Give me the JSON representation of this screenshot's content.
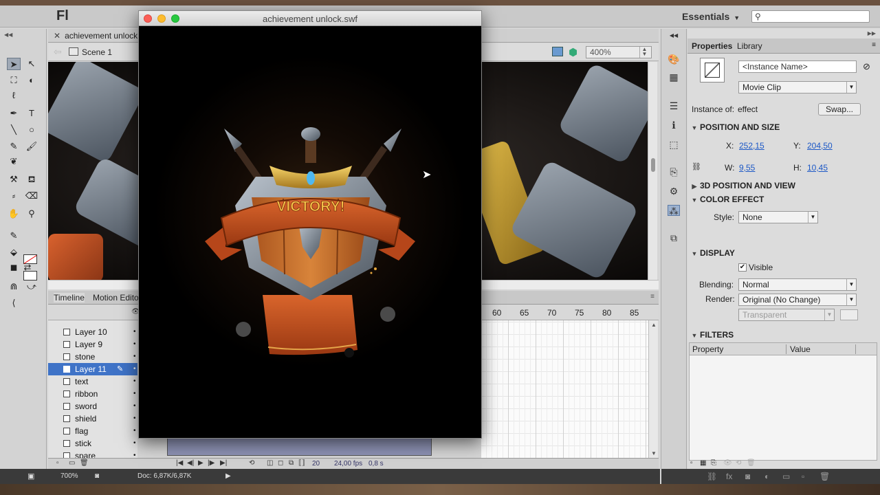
{
  "app": {
    "logo": "Fl",
    "workspace": "Essentials",
    "search_placeholder": ""
  },
  "document": {
    "tab_label": "achievement unlock.f",
    "scene_label": "Scene 1",
    "zoom": "400%"
  },
  "timeline": {
    "tabs": [
      "Timeline",
      "Motion Edito"
    ],
    "frame_numbers": [
      "60",
      "65",
      "70",
      "75",
      "80",
      "85"
    ],
    "layers": [
      {
        "name": "Layer 10",
        "selected": false
      },
      {
        "name": "Layer 9",
        "selected": false
      },
      {
        "name": "stone",
        "selected": false
      },
      {
        "name": "Layer 11",
        "selected": true
      },
      {
        "name": "text",
        "selected": false
      },
      {
        "name": "ribbon",
        "selected": false
      },
      {
        "name": "sword",
        "selected": false
      },
      {
        "name": "shield",
        "selected": false
      },
      {
        "name": "flag",
        "selected": false
      },
      {
        "name": "stick",
        "selected": false
      },
      {
        "name": "spare",
        "selected": false
      }
    ],
    "current_frame": "20",
    "fps": "24,00 fps",
    "elapsed": "0,8 s"
  },
  "preview_window": {
    "title": "achievement unlock.swf",
    "victory_text": "VICTORY!"
  },
  "properties": {
    "tabs": [
      "Properties",
      "Library"
    ],
    "instance_name_placeholder": "<Instance Name>",
    "symbol_type": "Movie Clip",
    "instance_of_label": "Instance of:",
    "instance_of_value": "effect",
    "swap_label": "Swap...",
    "position_and_size": {
      "header": "POSITION AND SIZE",
      "x_label": "X:",
      "x_value": "252,15",
      "y_label": "Y:",
      "y_value": "204,50",
      "w_label": "W:",
      "w_value": "9,55",
      "h_label": "H:",
      "h_value": "10,45"
    },
    "view_3d_header": "3D POSITION AND VIEW",
    "color_effect": {
      "header": "COLOR EFFECT",
      "style_label": "Style:",
      "style_value": "None"
    },
    "display": {
      "header": "DISPLAY",
      "visible_label": "Visible",
      "visible_checked": true,
      "blending_label": "Blending:",
      "blending_value": "Normal",
      "render_label": "Render:",
      "render_value": "Original (No Change)",
      "background_value": "Transparent"
    },
    "filters": {
      "header": "FILTERS",
      "columns": [
        "Property",
        "Value"
      ]
    }
  },
  "status": {
    "zoom": "700%",
    "doc_size": "Doc: 6,87K/6,87K"
  },
  "colors": {
    "selection_blue": "#3f73c7",
    "link_blue": "#1c58c6",
    "ribbon_orange": "#c9521f",
    "victory_gold": "#f7c54a"
  }
}
